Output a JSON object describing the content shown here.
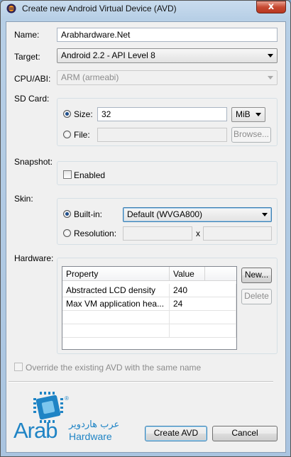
{
  "window": {
    "title": "Create new Android Virtual Device (AVD)",
    "close_glyph": "x",
    "icon": "eclipse-icon"
  },
  "form": {
    "name_label": "Name:",
    "name_value": "Arabhardware.Net",
    "target_label": "Target:",
    "target_value": "Android 2.2 - API Level 8",
    "cpu_label": "CPU/ABI:",
    "cpu_value": "ARM (armeabi)",
    "sdcard": {
      "label": "SD Card:",
      "size_label": "Size:",
      "size_value": "32",
      "unit_value": "MiB",
      "file_label": "File:",
      "file_value": "",
      "browse_label": "Browse..."
    },
    "snapshot": {
      "label": "Snapshot:",
      "enabled_label": "Enabled"
    },
    "skin": {
      "label": "Skin:",
      "builtin_label": "Built-in:",
      "builtin_value": "Default (WVGA800)",
      "resolution_label": "Resolution:",
      "x_label": "x",
      "res_width": "",
      "res_height": ""
    },
    "hardware": {
      "label": "Hardware:",
      "columns": [
        "Property",
        "Value"
      ],
      "rows": [
        {
          "property": "Abstracted LCD density",
          "value": "240"
        },
        {
          "property": "Max VM application hea...",
          "value": "24"
        }
      ],
      "new_label": "New...",
      "delete_label": "Delete"
    },
    "override_label": "Override the existing AVD with the same name"
  },
  "footer": {
    "logo": {
      "arab": "Arab",
      "hardware": "Hardware",
      "arabic": "عرب هاردوير",
      "registered": "®"
    },
    "create_label": "Create AVD",
    "cancel_label": "Cancel"
  },
  "colors": {
    "accent": "#3c7fb1",
    "logo_blue": "#1f84c5",
    "title_bar": "#b7cfe6"
  }
}
